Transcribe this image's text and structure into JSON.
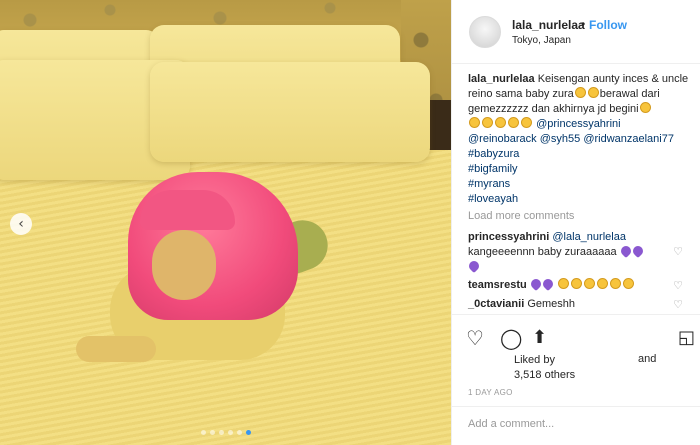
{
  "post": {
    "username": "lala_nurlelaa",
    "separator": "•",
    "follow_label": "Follow",
    "location": "Tokyo, Japan",
    "caption": {
      "username": "lala_nurlelaa",
      "text1": "Keisengan aunty inces & uncle reino sama baby zura",
      "text2": "berawal dari gemezzzzzz dan akhirnya jd begini",
      "mention1": "@princessyahrini",
      "mention2": "@reinobarack",
      "mention3": "@syh55",
      "mention4": "@ridwanzaelani77",
      "hashtags": [
        "#babyzura",
        "#bigfamily",
        "#myrans",
        "#loveayah"
      ]
    },
    "load_more_label": "Load more comments",
    "comments": [
      {
        "user": "princessyahrini",
        "mention": "@lala_nurlelaa",
        "text": "kangeeeennn baby zuraaaaaa"
      },
      {
        "user": "teamsrestu",
        "text": ""
      },
      {
        "user": "_0ctavianii",
        "text": "Gemeshh"
      }
    ],
    "liked_by_label": "Liked by",
    "likes_count": "3,518 others",
    "and_label": "and",
    "time_ago": "1 DAY AGO",
    "add_comment_placeholder": "Add a comment..."
  },
  "carousel": {
    "total": 6,
    "active": 6
  },
  "icons": {
    "nav_prev": "chevron-left-icon",
    "like": "heart-icon",
    "comment": "comment-icon",
    "share": "share-icon",
    "save": "bookmark-icon"
  },
  "colors": {
    "link": "#3897f0",
    "tag": "#003569",
    "muted": "#999999"
  }
}
